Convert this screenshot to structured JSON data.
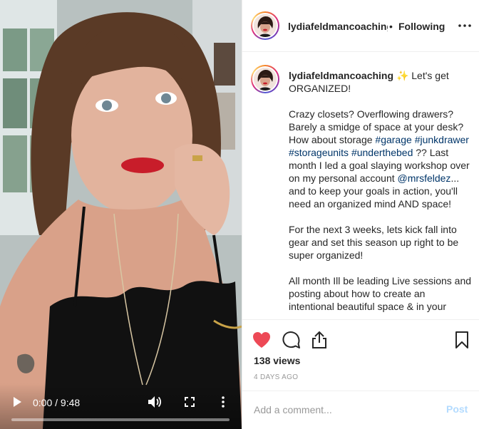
{
  "video": {
    "current_time": "0:00",
    "duration": "9:48",
    "time_separator": " / ",
    "progress": 0
  },
  "header": {
    "username": "lydiafeldmancoaching",
    "separator": "•",
    "follow_status": "Following",
    "more_icon": "ellipsis-icon"
  },
  "caption": {
    "username": "lydiafeldmancoaching",
    "emoji": "✨",
    "intro": "Let's get ORGANIZED!",
    "p2_a": "Crazy closets? Overflowing drawers? Barely a smidge of space at your desk? How about storage ",
    "tag_garage": "#garage",
    "tag_junkdrawer": "#junkdrawer",
    "tag_storageunits": "#storageunits",
    "tag_underthebed": "#underthebed",
    "p2_b": " ?? Last month I led a goal slaying workshop over on my personal account ",
    "mention": "@mrsfeldez",
    "p2_c": "... and to keep your goals in action, you'll need an organized mind AND space!",
    "p3": "For the next 3 weeks, lets kick fall into gear and set this season up right to be super organized!",
    "p4": "All month Ill be leading Live sessions and posting about how to create an intentional beautiful space & in your"
  },
  "actions": {
    "views": "138 views",
    "date": "4 DAYS AGO"
  },
  "comment_box": {
    "placeholder": "Add a comment...",
    "post_label": "Post"
  },
  "colors": {
    "like_red": "#ed4956",
    "link_blue": "#003569",
    "post_disabled": "#b3dbff"
  }
}
